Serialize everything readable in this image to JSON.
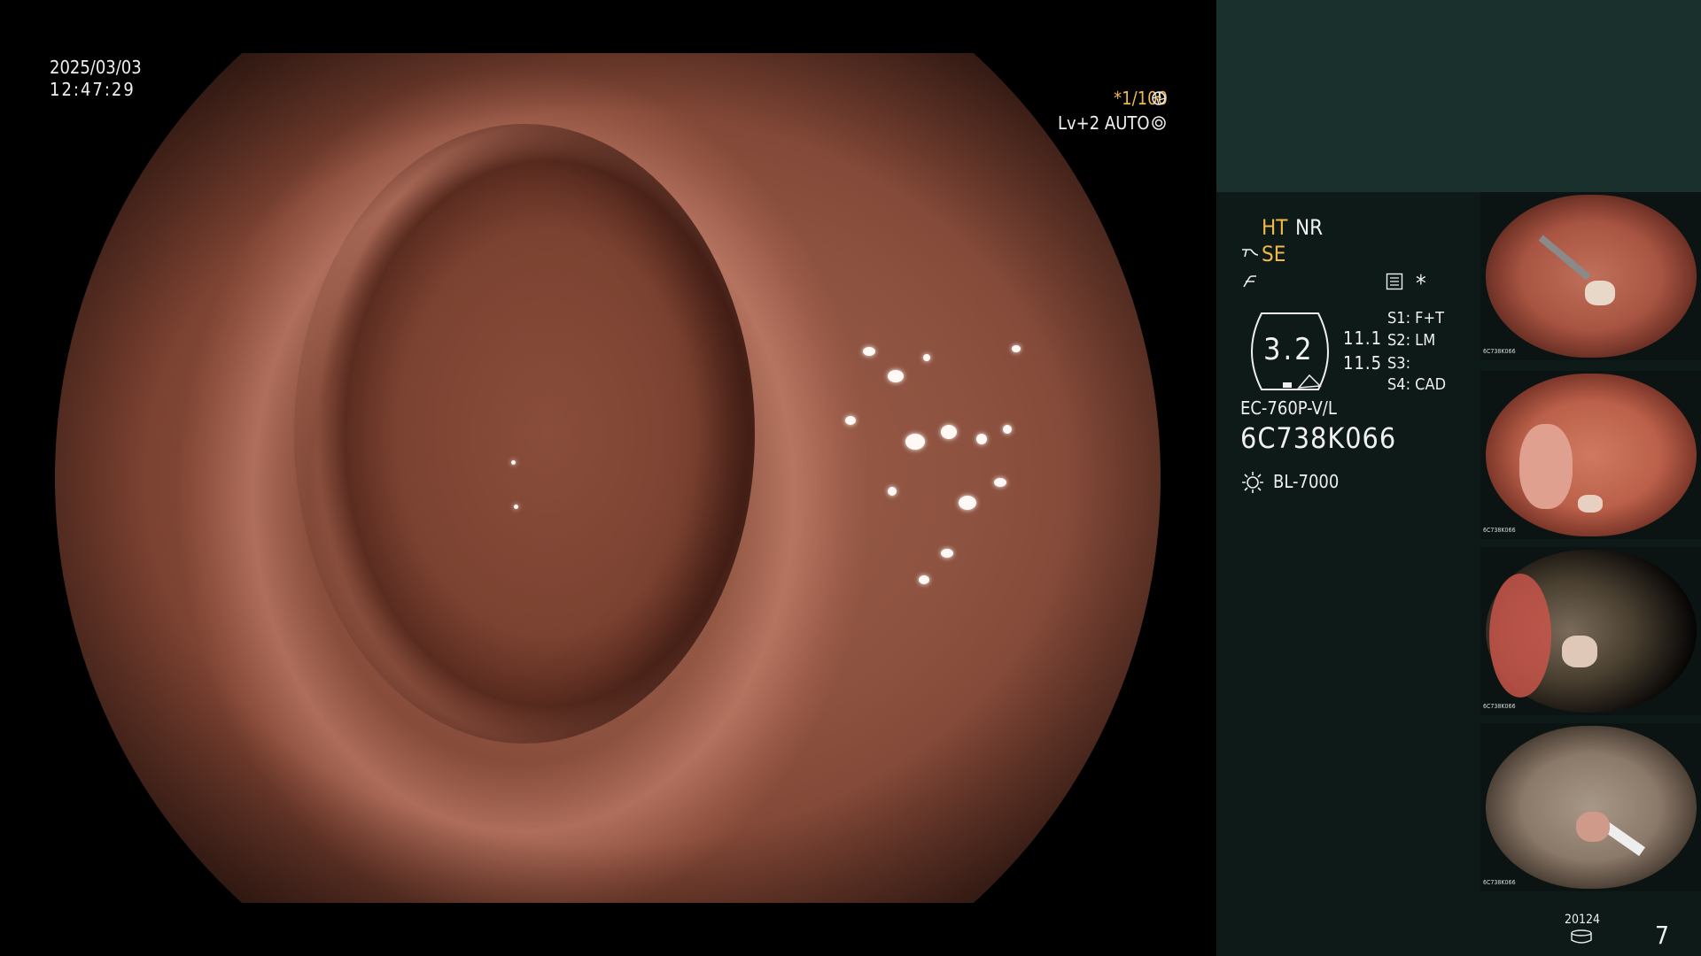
{
  "datetime": {
    "date": "2025/03/03",
    "time": "12:47:29"
  },
  "shutter": {
    "value": "*1/100",
    "icon": "shutter-icon"
  },
  "iris": {
    "value": "Lv+2 AUTO",
    "icon": "iris-icon"
  },
  "modes": {
    "ht": "HT",
    "nr": "NR",
    "se": "SE",
    "se_icon": "scope-tip-icon",
    "freeze_icon": "freeze-icon",
    "record_icon": "record-icon",
    "asterisk": "*"
  },
  "scale": {
    "value": "3.2",
    "top": "11.1",
    "bottom": "11.5"
  },
  "switches": [
    "S1: F+T",
    "S2: LM",
    "S3:",
    "S4: CAD"
  ],
  "scope_model": "EC-760P-V/L",
  "scope_serial": "6C738K066",
  "light_source": {
    "icon": "light-source-icon",
    "label": "BL-7000"
  },
  "footer": {
    "counter_label": "20124",
    "storage_icon": "storage-icon",
    "page": "7"
  },
  "thumbnails": [
    {
      "id": "6C738K066"
    },
    {
      "id": "6C738K066"
    },
    {
      "id": "6C738K066"
    },
    {
      "id": "6C738K066"
    }
  ]
}
